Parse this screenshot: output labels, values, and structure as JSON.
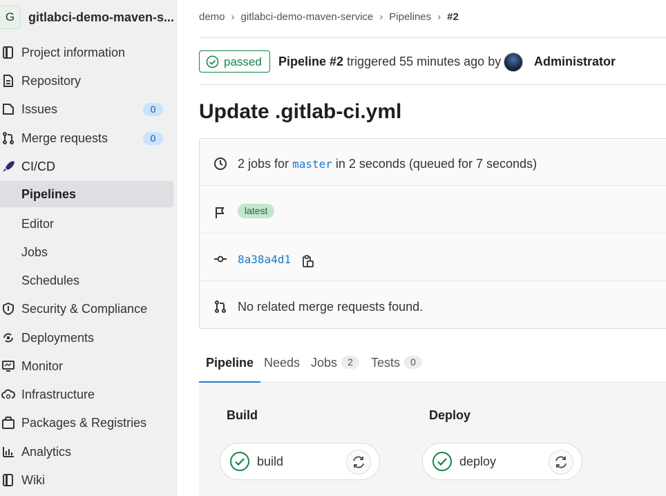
{
  "project": {
    "avatar_letter": "G",
    "name": "gitlabci-demo-maven-s..."
  },
  "sidebar": {
    "items": [
      {
        "label": "Project information",
        "icon": "project-info-icon"
      },
      {
        "label": "Repository",
        "icon": "repository-icon"
      },
      {
        "label": "Issues",
        "icon": "issues-icon",
        "count": "0"
      },
      {
        "label": "Merge requests",
        "icon": "merge-request-icon",
        "count": "0"
      },
      {
        "label": "CI/CD",
        "icon": "rocket-icon"
      },
      {
        "label": "Pipelines"
      },
      {
        "label": "Editor"
      },
      {
        "label": "Jobs"
      },
      {
        "label": "Schedules"
      },
      {
        "label": "Security & Compliance",
        "icon": "shield-icon"
      },
      {
        "label": "Deployments",
        "icon": "deployments-icon"
      },
      {
        "label": "Monitor",
        "icon": "monitor-icon"
      },
      {
        "label": "Infrastructure",
        "icon": "cloud-gear-icon"
      },
      {
        "label": "Packages & Registries",
        "icon": "package-icon"
      },
      {
        "label": "Analytics",
        "icon": "analytics-icon"
      },
      {
        "label": "Wiki",
        "icon": "book-icon"
      }
    ]
  },
  "breadcrumb": {
    "items": [
      "demo",
      "gitlabci-demo-maven-service",
      "Pipelines",
      "#2"
    ],
    "separator": "›"
  },
  "pipeline": {
    "status": "passed",
    "id_label": "Pipeline #2",
    "triggered_text": "triggered 55 minutes ago by",
    "user": "Administrator",
    "title": "Update .gitlab-ci.yml",
    "jobs_prefix": "2 jobs for",
    "branch": "master",
    "jobs_suffix": "in 2 seconds (queued for 7 seconds)",
    "tag": "latest",
    "commit": "8a38a4d1",
    "mr_text": "No related merge requests found."
  },
  "tabs": [
    {
      "label": "Pipeline"
    },
    {
      "label": "Needs"
    },
    {
      "label": "Jobs",
      "count": "2"
    },
    {
      "label": "Tests",
      "count": "0"
    }
  ],
  "stages": [
    {
      "title": "Build",
      "job": "build"
    },
    {
      "title": "Deploy",
      "job": "deploy"
    }
  ],
  "colors": {
    "success": "#108548",
    "link": "#1f75cb",
    "sidebar_bg": "#f0f0f0"
  }
}
